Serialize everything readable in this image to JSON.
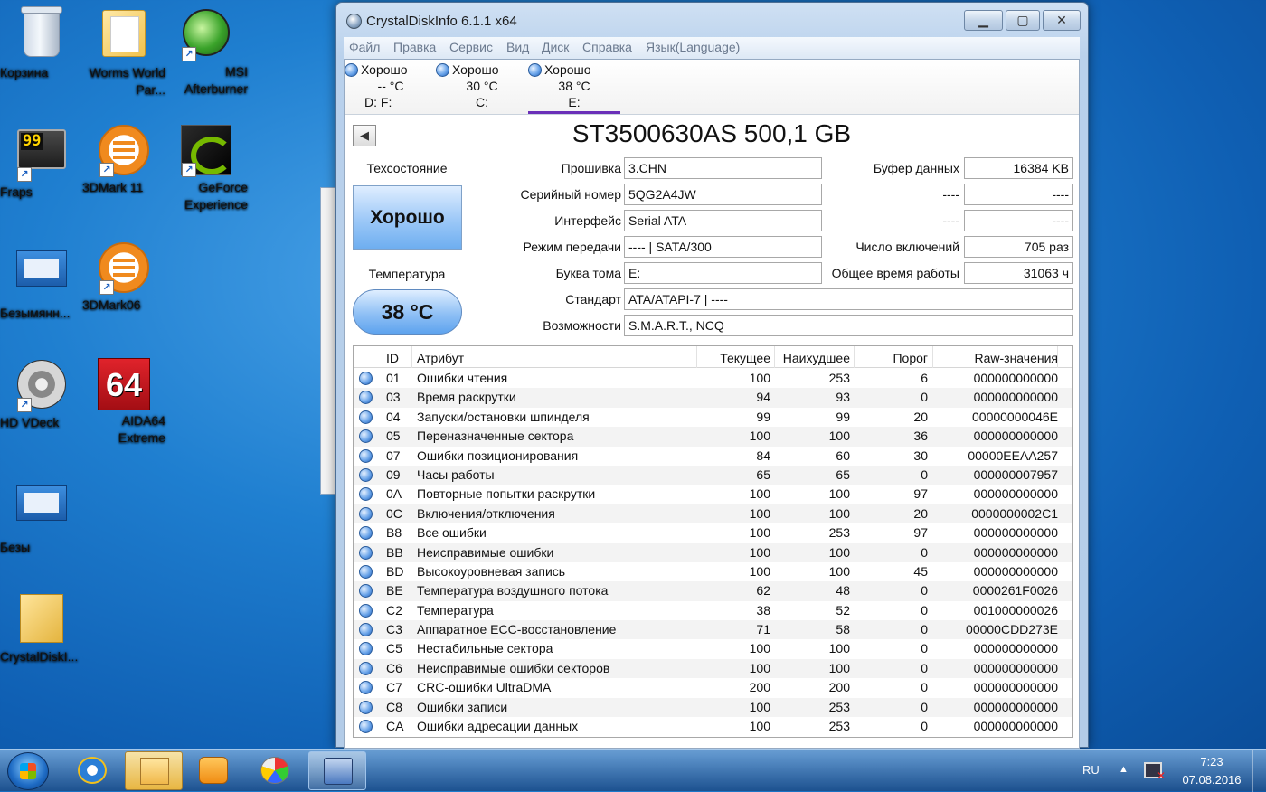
{
  "desktop": {
    "icons": [
      {
        "label": "Корзина",
        "icon": "recycle-bin-icon"
      },
      {
        "label": "Worms World Par...",
        "icon": "folder-icon"
      },
      {
        "label": "MSI Afterburner",
        "icon": "msi-afterburner-icon"
      },
      {
        "label": "Fraps",
        "icon": "fraps-icon"
      },
      {
        "label": "3DMark 11",
        "icon": "3dmark-icon"
      },
      {
        "label": "GeForce Experience",
        "icon": "nvidia-icon"
      },
      {
        "label": "Безымянн...",
        "icon": "window-screenshot-icon"
      },
      {
        "label": "3DMark06",
        "icon": "3dmark-icon"
      },
      {
        "label": "HD VDeck",
        "icon": "hdvdeck-icon"
      },
      {
        "label": "AIDA64 Extreme",
        "icon": "aida64-icon"
      },
      {
        "label": "Безы",
        "icon": "window-screenshot-icon"
      },
      {
        "label": "CrystalDiskI...",
        "icon": "folder-icon"
      }
    ],
    "fraps_badge": "99",
    "aida_badge": "64"
  },
  "window": {
    "title": "CrystalDiskInfo 6.1.1 x64",
    "menu": [
      "Файл",
      "Правка",
      "Сервис",
      "Вид",
      "Диск",
      "Справка",
      "Язык(Language)"
    ],
    "drives": [
      {
        "status": "Хорошо",
        "temp": "-- °C",
        "letters": "D: F:"
      },
      {
        "status": "Хорошо",
        "temp": "30 °C",
        "letters": "C:"
      },
      {
        "status": "Хорошо",
        "temp": "38 °C",
        "letters": "E:"
      }
    ],
    "model": "ST3500630AS 500,1 GB",
    "health_label": "Техсостояние",
    "health_value": "Хорошо",
    "temp_label": "Температура",
    "temp_value": "38 °C",
    "info": {
      "firmware_label": "Прошивка",
      "firmware": "3.CHN",
      "serial_label": "Серийный номер",
      "serial": "5QG2A4JW",
      "interface_label": "Интерфейс",
      "interface": "Serial ATA",
      "transfer_label": "Режим передачи",
      "transfer": "---- | SATA/300",
      "volume_label": "Буква тома",
      "volume": "E:",
      "standard_label": "Стандарт",
      "standard": "ATA/ATAPI-7 | ----",
      "features_label": "Возможности",
      "features": "S.M.A.R.T., NCQ",
      "buffer_label": "Буфер данных",
      "buffer": "16384 KB",
      "blank1_label": "----",
      "blank1": "----",
      "blank2_label": "----",
      "blank2": "----",
      "power_count_label": "Число включений",
      "power_count": "705 раз",
      "power_hours_label": "Общее время работы",
      "power_hours": "31063 ч"
    },
    "table": {
      "headers": {
        "id": "ID",
        "name": "Атрибут",
        "current": "Текущее",
        "worst": "Наихудшее",
        "threshold": "Порог",
        "raw": "Raw-значения"
      },
      "rows": [
        {
          "id": "01",
          "name": "Ошибки чтения",
          "current": "100",
          "worst": "253",
          "threshold": "6",
          "raw": "000000000000"
        },
        {
          "id": "03",
          "name": "Время раскрутки",
          "current": "94",
          "worst": "93",
          "threshold": "0",
          "raw": "000000000000"
        },
        {
          "id": "04",
          "name": "Запуски/остановки шпинделя",
          "current": "99",
          "worst": "99",
          "threshold": "20",
          "raw": "00000000046E"
        },
        {
          "id": "05",
          "name": "Переназначенные сектора",
          "current": "100",
          "worst": "100",
          "threshold": "36",
          "raw": "000000000000"
        },
        {
          "id": "07",
          "name": "Ошибки позиционирования",
          "current": "84",
          "worst": "60",
          "threshold": "30",
          "raw": "00000EEAA257"
        },
        {
          "id": "09",
          "name": "Часы работы",
          "current": "65",
          "worst": "65",
          "threshold": "0",
          "raw": "000000007957"
        },
        {
          "id": "0A",
          "name": "Повторные попытки раскрутки",
          "current": "100",
          "worst": "100",
          "threshold": "97",
          "raw": "000000000000"
        },
        {
          "id": "0C",
          "name": "Включения/отключения",
          "current": "100",
          "worst": "100",
          "threshold": "20",
          "raw": "0000000002C1"
        },
        {
          "id": "B8",
          "name": "Все ошибки",
          "current": "100",
          "worst": "253",
          "threshold": "97",
          "raw": "000000000000"
        },
        {
          "id": "BB",
          "name": "Неисправимые ошибки",
          "current": "100",
          "worst": "100",
          "threshold": "0",
          "raw": "000000000000"
        },
        {
          "id": "BD",
          "name": "Высокоуровневая запись",
          "current": "100",
          "worst": "100",
          "threshold": "45",
          "raw": "000000000000"
        },
        {
          "id": "BE",
          "name": "Температура воздушного потока",
          "current": "62",
          "worst": "48",
          "threshold": "0",
          "raw": "0000261F0026"
        },
        {
          "id": "C2",
          "name": "Температура",
          "current": "38",
          "worst": "52",
          "threshold": "0",
          "raw": "001000000026"
        },
        {
          "id": "C3",
          "name": "Аппаратное ECC-восстановление",
          "current": "71",
          "worst": "58",
          "threshold": "0",
          "raw": "00000CDD273E"
        },
        {
          "id": "C5",
          "name": "Нестабильные сектора",
          "current": "100",
          "worst": "100",
          "threshold": "0",
          "raw": "000000000000"
        },
        {
          "id": "C6",
          "name": "Неисправимые ошибки секторов",
          "current": "100",
          "worst": "100",
          "threshold": "0",
          "raw": "000000000000"
        },
        {
          "id": "C7",
          "name": "CRC-ошибки UltraDMA",
          "current": "200",
          "worst": "200",
          "threshold": "0",
          "raw": "000000000000"
        },
        {
          "id": "C8",
          "name": "Ошибки записи",
          "current": "100",
          "worst": "253",
          "threshold": "0",
          "raw": "000000000000"
        },
        {
          "id": "CA",
          "name": "Ошибки адресации данных",
          "current": "100",
          "worst": "253",
          "threshold": "0",
          "raw": "000000000000"
        }
      ]
    }
  },
  "taskbar": {
    "apps": [
      "start-orb",
      "internet-explorer",
      "explorer",
      "media-player",
      "paint",
      "crystaldiskinfo"
    ],
    "lang": "RU",
    "time": "7:23",
    "date": "07.08.2016"
  }
}
